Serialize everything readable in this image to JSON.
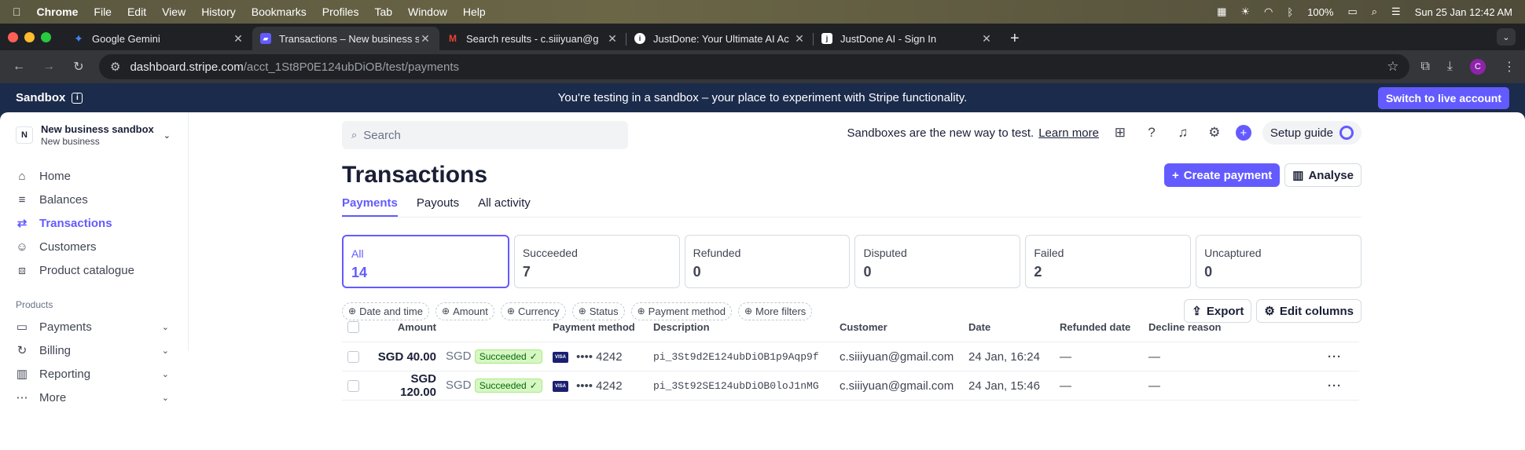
{
  "menubar": {
    "apple_icon": "apple-icon",
    "app": "Chrome",
    "items": [
      "File",
      "Edit",
      "View",
      "History",
      "Bookmarks",
      "Profiles",
      "Tab",
      "Window",
      "Help"
    ],
    "battery": "100%",
    "clock": "Sun 25 Jan  12:42 AM"
  },
  "tabs": [
    {
      "title": "Google Gemini",
      "favicon": "gemini-icon",
      "color": "#4285f4"
    },
    {
      "title": "Transactions – New business s",
      "favicon": "stripe-icon",
      "color": "#635bff"
    },
    {
      "title": "Search results - c.siiiyuan@g",
      "favicon": "gmail-icon",
      "color": "#ea4335"
    },
    {
      "title": "JustDone: Your Ultimate AI Ac",
      "favicon": "info-icon",
      "color": "#ffffff"
    },
    {
      "title": "JustDone AI - Sign In",
      "favicon": "j-icon",
      "color": "#ffffff"
    }
  ],
  "address": {
    "host": "dashboard.stripe.com",
    "path": "/acct_1St8P0E124ubDiOB/test/payments"
  },
  "profile_initial": "C",
  "banner": {
    "label": "Sandbox",
    "message": "You're testing in a sandbox – your place to experiment with Stripe functionality.",
    "button": "Switch to live account"
  },
  "account": {
    "initial": "N",
    "name": "New business sandbox",
    "sub": "New business"
  },
  "nav": [
    {
      "label": "Home",
      "icon": "home-icon"
    },
    {
      "label": "Balances",
      "icon": "balances-icon"
    },
    {
      "label": "Transactions",
      "icon": "transactions-icon"
    },
    {
      "label": "Customers",
      "icon": "customers-icon"
    },
    {
      "label": "Product catalogue",
      "icon": "product-icon"
    }
  ],
  "products_label": "Products",
  "products": [
    {
      "label": "Payments"
    },
    {
      "label": "Billing"
    },
    {
      "label": "Reporting"
    },
    {
      "label": "More"
    }
  ],
  "topbar": {
    "search_placeholder": "Search",
    "sandbox_text": "Sandboxes are the new way to test.",
    "learn_more": "Learn more",
    "setup_guide": "Setup guide"
  },
  "page": {
    "title": "Transactions",
    "create_payment": "Create payment",
    "analyse": "Analyse",
    "tabs": [
      "Payments",
      "Payouts",
      "All activity"
    ]
  },
  "summary": [
    {
      "label": "All",
      "value": "14"
    },
    {
      "label": "Succeeded",
      "value": "7"
    },
    {
      "label": "Refunded",
      "value": "0"
    },
    {
      "label": "Disputed",
      "value": "0"
    },
    {
      "label": "Failed",
      "value": "2"
    },
    {
      "label": "Uncaptured",
      "value": "0"
    }
  ],
  "filters": [
    "Date and time",
    "Amount",
    "Currency",
    "Status",
    "Payment method",
    "More filters"
  ],
  "export": "Export",
  "edit_columns": "Edit columns",
  "table": {
    "headers": [
      "Amount",
      "Payment method",
      "Description",
      "Customer",
      "Date",
      "Refunded date",
      "Decline reason"
    ],
    "rows": [
      {
        "amount": "SGD 40.00",
        "currency": "SGD",
        "status": "Succeeded",
        "card": "•••• 4242",
        "description": "pi_3St9d2E124ubDiOB1p9Aqp9f",
        "customer": "c.siiiyuan@gmail.com",
        "date": "24 Jan, 16:24",
        "refunded": "—",
        "decline": "—"
      },
      {
        "amount": "SGD 120.00",
        "currency": "SGD",
        "status": "Succeeded",
        "card": "•••• 4242",
        "description": "pi_3St92SE124ubDiOB0loJ1nMG",
        "customer": "c.siiiyuan@gmail.com",
        "date": "24 Jan, 15:46",
        "refunded": "—",
        "decline": "—"
      }
    ]
  }
}
